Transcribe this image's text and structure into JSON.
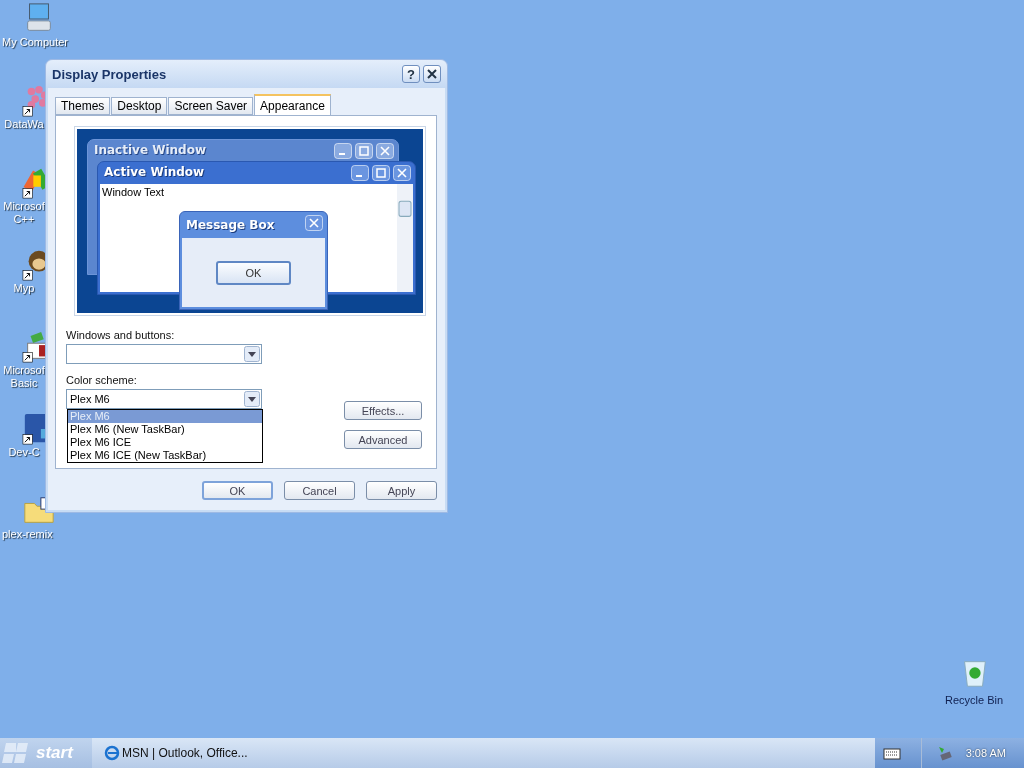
{
  "desktop_icons": [
    {
      "label_lines": [
        "My Computer"
      ],
      "kind": "computer",
      "shortcut": false
    },
    {
      "label_lines": [
        "DataWa"
      ],
      "kind": "molecule",
      "shortcut": true
    },
    {
      "label_lines": [
        "Microsof",
        "C++"
      ],
      "kind": "tools",
      "shortcut": true
    },
    {
      "label_lines": [
        "Myp"
      ],
      "kind": "monkey",
      "shortcut": true
    },
    {
      "label_lines": [
        "Microsof",
        "Basic"
      ],
      "kind": "basic",
      "shortcut": true
    },
    {
      "label_lines": [
        "Dev-C"
      ],
      "kind": "devcpp",
      "shortcut": true
    },
    {
      "label_lines": [
        "plex-remix"
      ],
      "kind": "folder",
      "shortcut": false
    }
  ],
  "recycle_bin": {
    "label": "Recycle Bin"
  },
  "dialog": {
    "title": "Display Properties",
    "help": "?",
    "tabs": [
      {
        "label": "Themes",
        "selected": false
      },
      {
        "label": "Desktop",
        "selected": false
      },
      {
        "label": "Screen Saver",
        "selected": false
      },
      {
        "label": "Appearance",
        "selected": true
      }
    ],
    "preview": {
      "inactive_title": "Inactive Window",
      "active_title": "Active Window",
      "window_text": "Window Text",
      "message_title": "Message Box",
      "message_button": "OK"
    },
    "windows_and_buttons": {
      "label": "Windows and buttons:"
    },
    "color_scheme": {
      "label": "Color scheme:",
      "value": "Plex M6",
      "expanded": true,
      "options": [
        {
          "label": "Plex M6",
          "selected": true
        },
        {
          "label": "Plex M6 (New TaskBar)",
          "selected": false
        },
        {
          "label": "Plex M6 ICE",
          "selected": false
        },
        {
          "label": "Plex M6 ICE (New TaskBar)",
          "selected": false
        }
      ]
    },
    "side_buttons": [
      "Effects...",
      "Advanced"
    ],
    "buttons": [
      {
        "label": "OK",
        "default": true
      },
      {
        "label": "Cancel",
        "default": false
      },
      {
        "label": "Apply",
        "default": false
      }
    ]
  },
  "taskbar": {
    "start": "start",
    "tasks": [
      "MSN | Outlook, Office..."
    ],
    "clock": "3:08 AM"
  }
}
